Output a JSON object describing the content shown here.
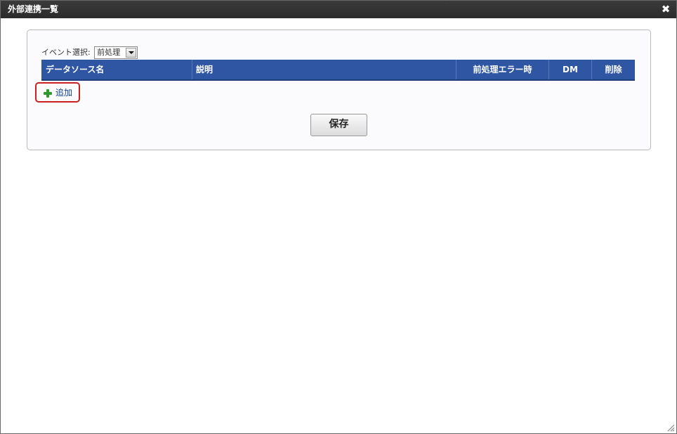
{
  "dialog": {
    "title": "外部連携一覧",
    "close_icon": "close-icon"
  },
  "event_select": {
    "label": "イベント選択:",
    "value": "前処理"
  },
  "grid": {
    "columns": [
      "データソース名",
      "説明",
      "前処理エラー時",
      "DM",
      "削除"
    ],
    "rows": []
  },
  "add_button": {
    "label": "追加",
    "icon": "plus-icon"
  },
  "save_button": {
    "label": "保存"
  },
  "colors": {
    "titlebar": "#333333",
    "header": "#2f56a3",
    "highlight": "#cc1f1f",
    "plus": "#2e9a2e"
  }
}
